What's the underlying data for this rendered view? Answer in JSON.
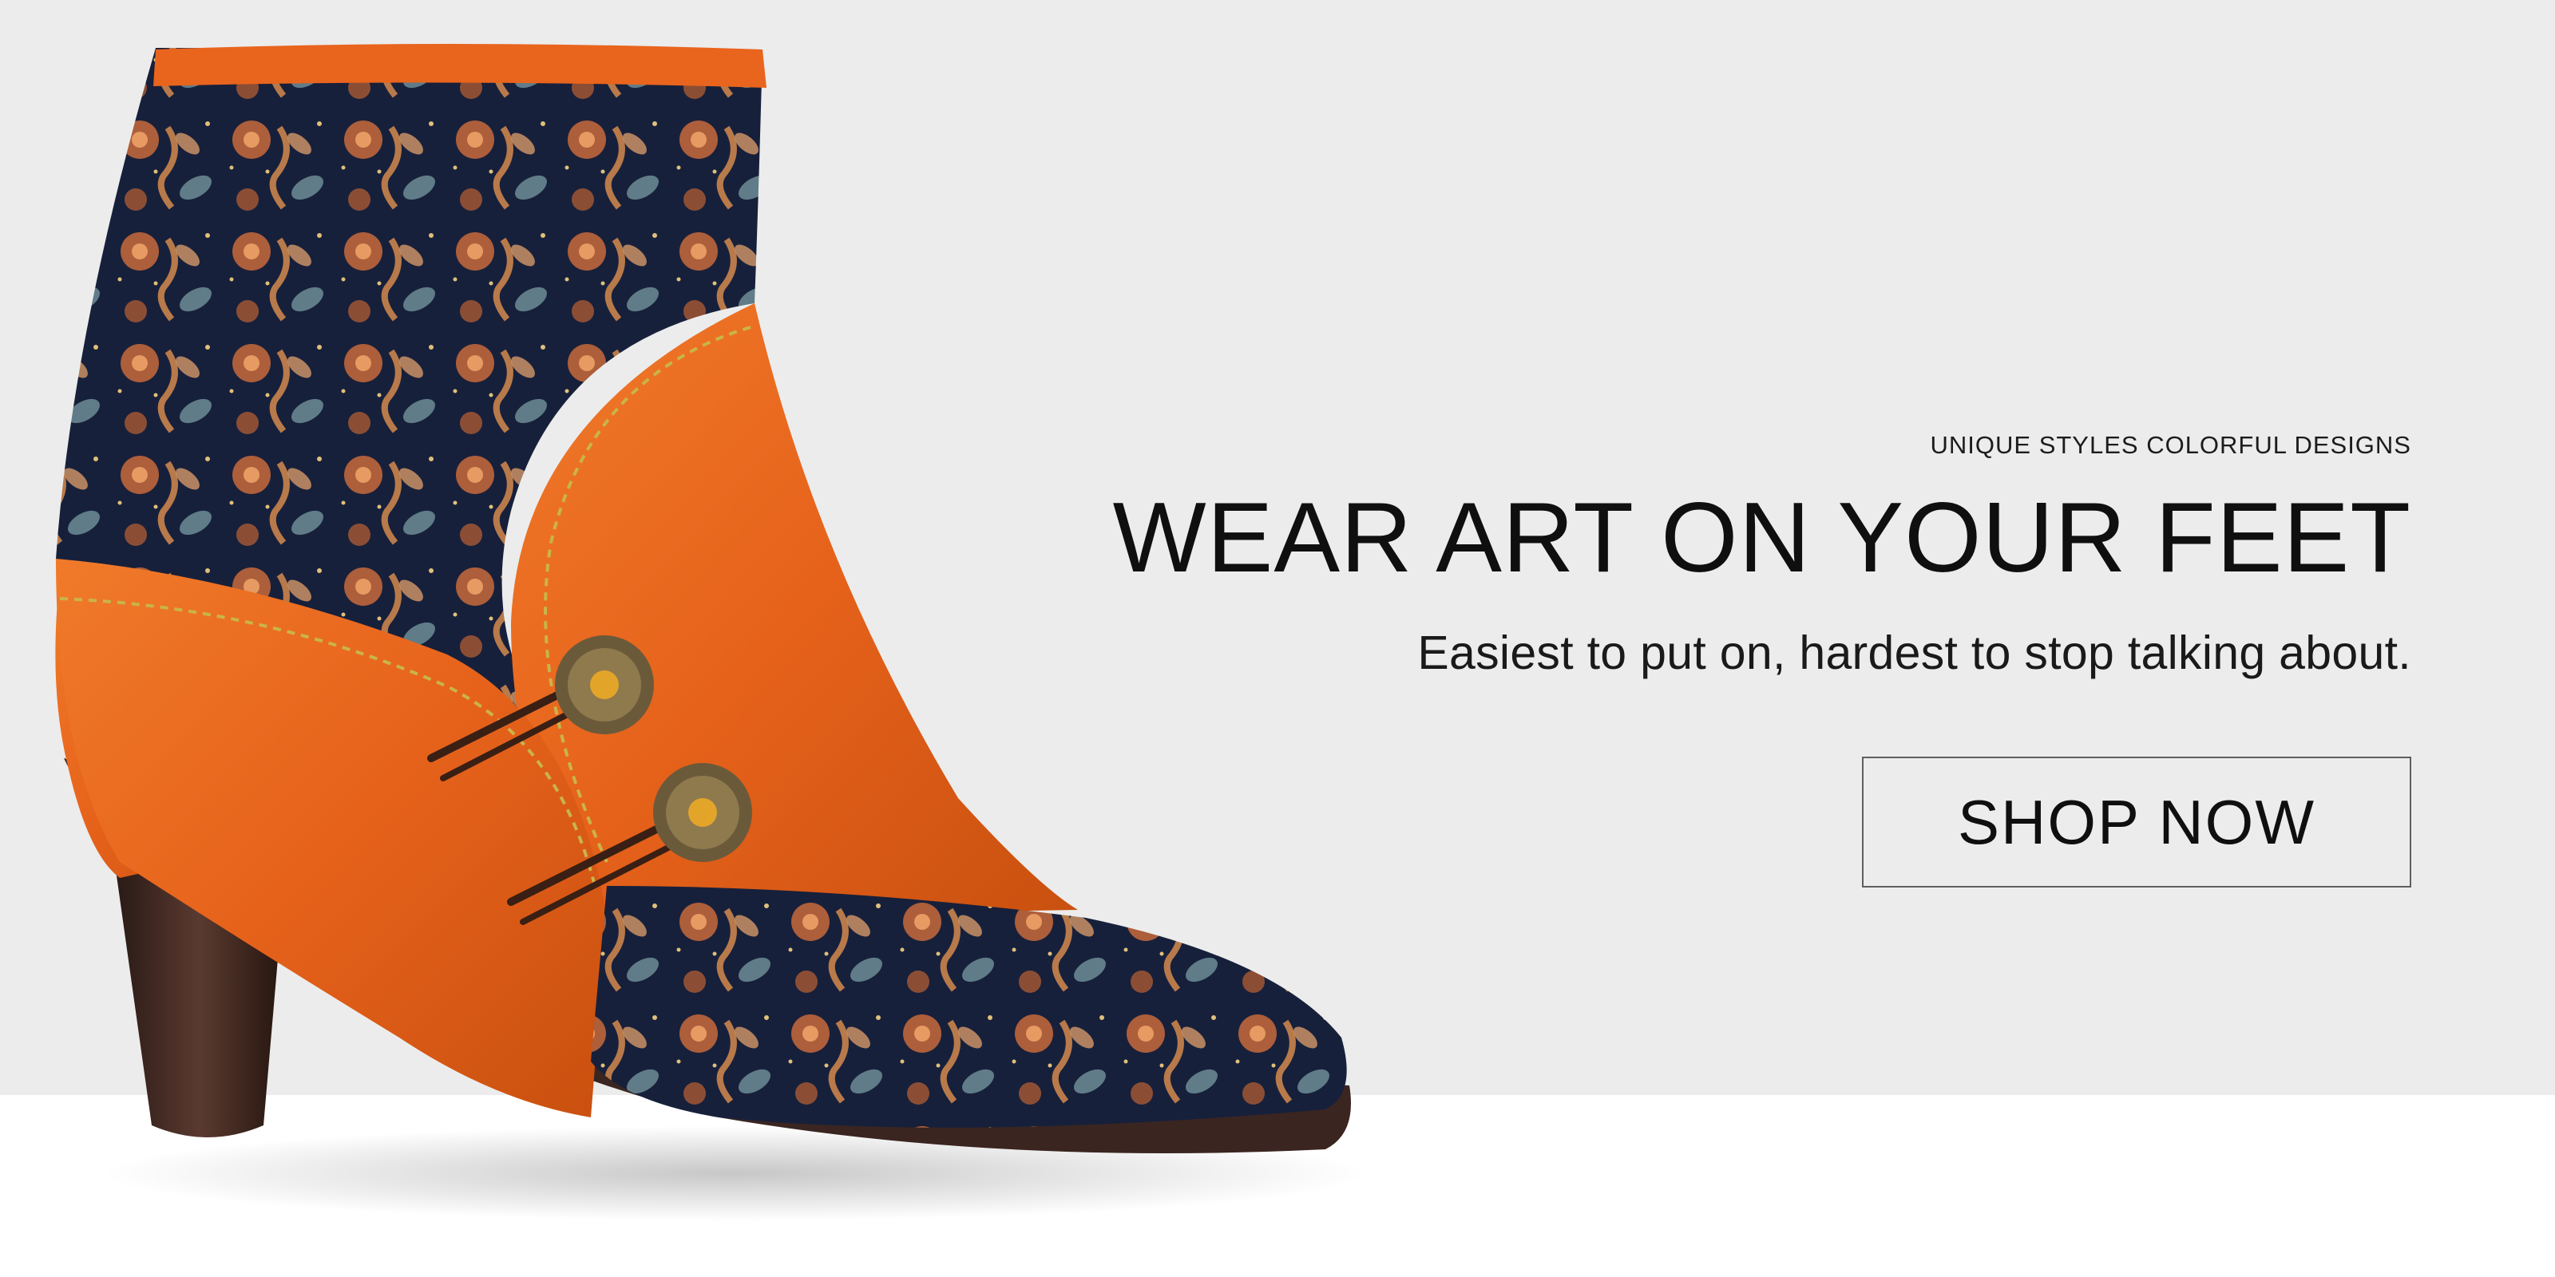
{
  "hero": {
    "eyebrow": "UNIQUE STYLES COLORFUL DESIGNS",
    "headline": "WEAR ART ON YOUR FEET",
    "tagline": "Easiest to put on, hardest to stop talking about.",
    "cta_label": "SHOP NOW"
  },
  "image": {
    "subject": "orange-leather-floral-ankle-boot"
  },
  "colors": {
    "background": "#ececec",
    "floor": "#ffffff",
    "text": "#0f0f0f",
    "leather": "#e9641d",
    "floral_base": "#17203b",
    "sole": "#3a2520"
  }
}
